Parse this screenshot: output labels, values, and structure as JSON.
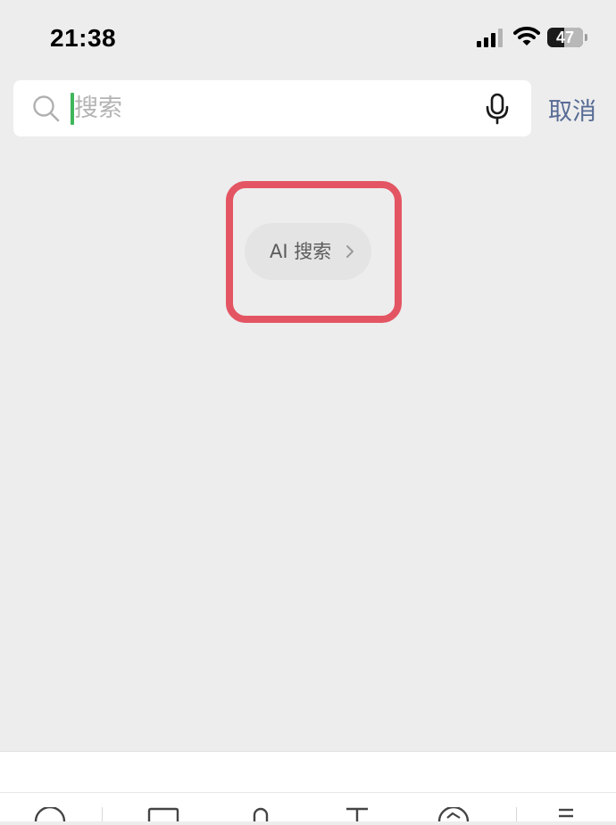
{
  "status_bar": {
    "time": "21:38",
    "battery_level": "47",
    "battery_fraction": 0.47
  },
  "search": {
    "placeholder": "搜索",
    "value": "",
    "cancel_label": "取消"
  },
  "ai_search": {
    "label": "AI 搜索"
  },
  "icons": {
    "search": "search-icon",
    "mic": "mic-icon",
    "chevron": "chevron-right-icon",
    "signal": "cellular-signal-icon",
    "wifi": "wifi-icon",
    "battery": "battery-icon"
  },
  "colors": {
    "background": "#ededed",
    "caret": "#3fb65b",
    "cancel": "#576b95",
    "highlight": "#e45563"
  }
}
